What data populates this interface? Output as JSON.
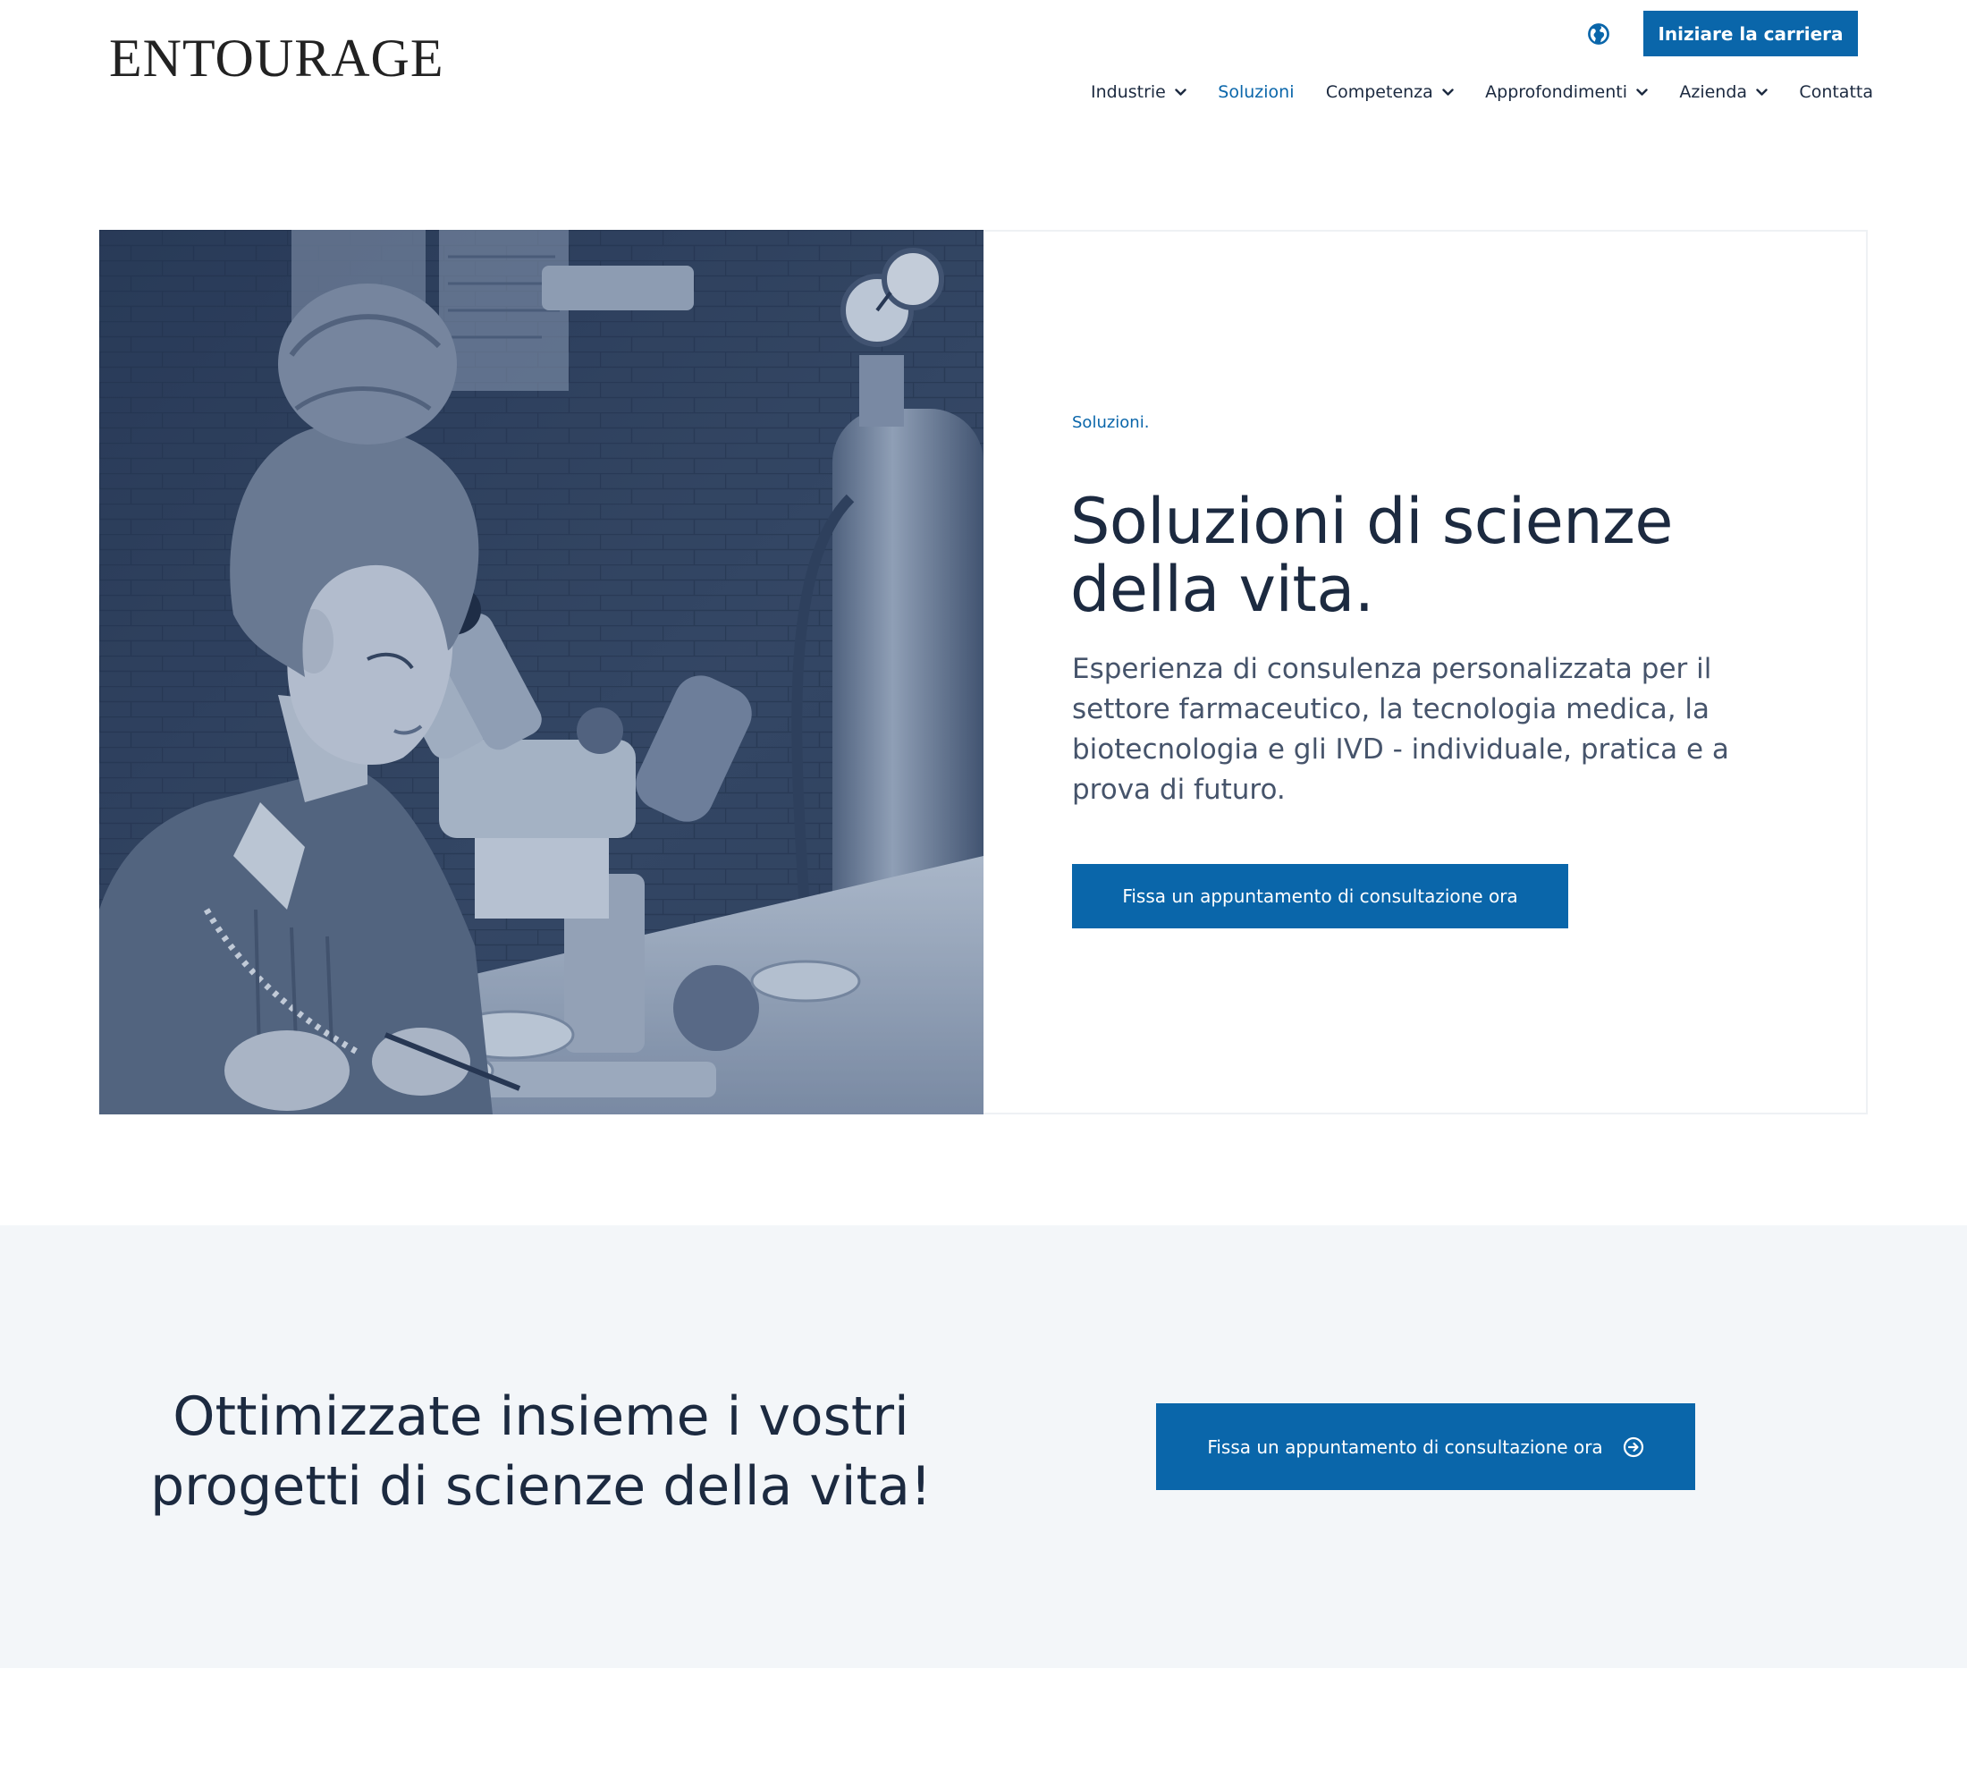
{
  "header": {
    "logo": "ENTOURAGE",
    "language_icon": "globe-icon",
    "career_button": "Iniziare la carriera",
    "nav": [
      {
        "label": "Industrie",
        "has_dropdown": true,
        "active": false
      },
      {
        "label": "Soluzioni",
        "has_dropdown": false,
        "active": true
      },
      {
        "label": "Competenza",
        "has_dropdown": true,
        "active": false
      },
      {
        "label": "Approfondimenti",
        "has_dropdown": true,
        "active": false
      },
      {
        "label": "Azienda",
        "has_dropdown": true,
        "active": false
      },
      {
        "label": "Contatta",
        "has_dropdown": false,
        "active": false
      }
    ]
  },
  "hero": {
    "image": "laboratory-microscope-photo",
    "eyebrow": "Soluzioni.",
    "title": "Soluzioni di scienze della vita.",
    "description": "Esperienza di consulenza personalizzata per il settore farmaceutico, la tecnologia medica, la biotecnologia e gli IVD - individuale, pratica e a prova di futuro.",
    "button": "Fissa un appuntamento di consultazione ora"
  },
  "cta": {
    "title": "Ottimizzate insieme i vostri progetti di scienze della vita!",
    "button": "Fissa un appuntamento di consultazione ora",
    "button_icon": "arrow-right-circle-icon"
  },
  "colors": {
    "brand_blue": "#0a66aa",
    "heading": "#1c2a40",
    "body_text": "#46546b",
    "band_background": "#f3f6f9"
  }
}
